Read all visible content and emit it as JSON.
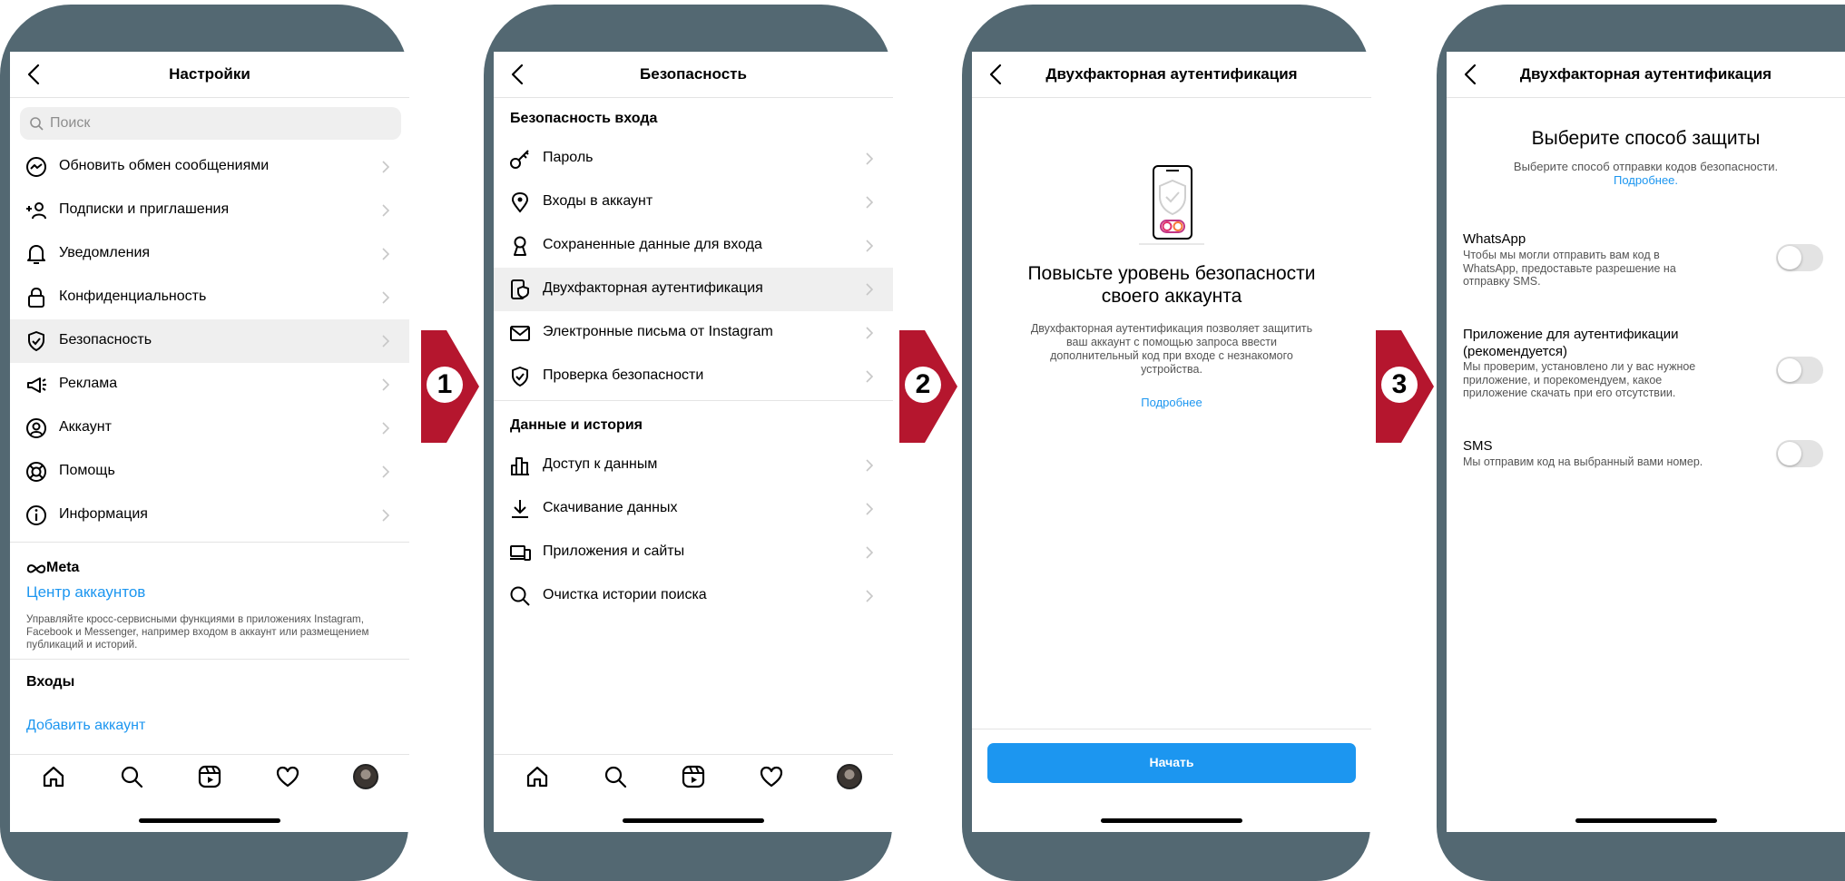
{
  "colors": {
    "frame": "#536872",
    "arrow": "#b5162e",
    "link": "#1c96f0",
    "button": "#1c96f0"
  },
  "steps": [
    "1",
    "2",
    "3"
  ],
  "screen1": {
    "title": "Настройки",
    "search_placeholder": "Поиск",
    "items": [
      {
        "icon": "messenger-icon",
        "label": "Обновить обмен сообщениями"
      },
      {
        "icon": "add-person-icon",
        "label": "Подписки и приглашения"
      },
      {
        "icon": "bell-icon",
        "label": "Уведомления"
      },
      {
        "icon": "lock-icon",
        "label": "Конфиденциальность"
      },
      {
        "icon": "shield-icon",
        "label": "Безопасность"
      },
      {
        "icon": "megaphone-icon",
        "label": "Реклама"
      },
      {
        "icon": "account-icon",
        "label": "Аккаунт"
      },
      {
        "icon": "lifebuoy-icon",
        "label": "Помощь"
      },
      {
        "icon": "info-icon",
        "label": "Информация"
      }
    ],
    "meta_label": "Meta",
    "accounts_center": "Центр аккаунтов",
    "meta_desc": "Управляйте кросс-сервисными функциями в приложениях Instagram, Facebook и Messenger, например входом в аккаунт или размещением публикаций и историй.",
    "logins_title": "Входы",
    "add_account": "Добавить аккаунт"
  },
  "screen2": {
    "title": "Безопасность",
    "section1": "Безопасность входа",
    "items1": [
      {
        "icon": "key-icon",
        "label": "Пароль"
      },
      {
        "icon": "location-pin-icon",
        "label": "Входы в аккаунт"
      },
      {
        "icon": "keyhole-icon",
        "label": "Сохраненные данные для входа"
      },
      {
        "icon": "phone-shield-icon",
        "label": "Двухфакторная аутентификация"
      },
      {
        "icon": "mail-icon",
        "label": "Электронные письма от Instagram"
      },
      {
        "icon": "shield-check-icon",
        "label": "Проверка безопасности"
      }
    ],
    "section2": "Данные и история",
    "items2": [
      {
        "icon": "bar-chart-icon",
        "label": "Доступ к данным"
      },
      {
        "icon": "download-icon",
        "label": "Скачивание данных"
      },
      {
        "icon": "devices-icon",
        "label": "Приложения и сайты"
      },
      {
        "icon": "search-icon",
        "label": "Очистка истории поиска"
      }
    ]
  },
  "screen3": {
    "title": "Двухфакторная аутентификация",
    "heading_line1": "Повысьте уровень безопасности",
    "heading_line2": "своего аккаунта",
    "desc_line1": "Двухфакторная аутентификация позволяет защитить",
    "desc_line2": "ваш аккаунт с помощью запроса ввести",
    "desc_line3": "дополнительный код при входе с незнакомого",
    "desc_line4": "устройства.",
    "learn_more": "Подробнее",
    "start_button": "Начать"
  },
  "screen4": {
    "title": "Двухфакторная аутентификация",
    "heading": "Выберите способ защиты",
    "sub": "Выберите способ отправки кодов безопасности.",
    "learn_more": "Подробнее.",
    "options": [
      {
        "title_line1": "WhatsApp",
        "title_line2": "",
        "desc_line1": "Чтобы мы могли отправить вам код в",
        "desc_line2": "WhatsApp, предоставьте разрешение на",
        "desc_line3": "отправку SMS.",
        "enabled": false
      },
      {
        "title_line1": "Приложение для аутентификации",
        "title_line2": "(рекомендуется)",
        "desc_line1": "Мы проверим, установлено ли у вас нужное",
        "desc_line2": "приложение, и порекомендуем, какое",
        "desc_line3": "приложение скачать при его отсутствии.",
        "enabled": false
      },
      {
        "title_line1": "SMS",
        "title_line2": "",
        "desc_line1": "Мы отправим код на выбранный вами номер.",
        "desc_line2": "",
        "desc_line3": "",
        "enabled": false
      }
    ]
  }
}
